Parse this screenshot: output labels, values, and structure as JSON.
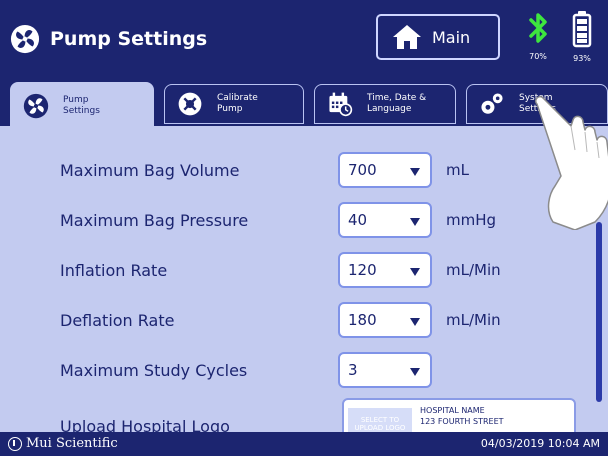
{
  "header": {
    "title": "Pump Settings",
    "main_button_label": "Main",
    "bluetooth_level": "70%",
    "battery_level": "93%",
    "title_icon": "fan-icon",
    "main_icon": "home-icon",
    "bluetooth_icon": "bluetooth-icon",
    "battery_icon": "battery-icon"
  },
  "tabs": [
    {
      "label": "Pump\nSettings",
      "icon": "fan-icon",
      "active": true
    },
    {
      "label": "Calibrate\nPump",
      "icon": "calibrate-icon",
      "active": false
    },
    {
      "label": "Time, Date &\nLanguage",
      "icon": "calendar-clock-icon",
      "active": false
    },
    {
      "label": "System\nSettings",
      "icon": "gears-icon",
      "active": false
    }
  ],
  "settings": [
    {
      "label": "Maximum Bag Volume",
      "value": "700",
      "unit": "mL"
    },
    {
      "label": "Maximum Bag Pressure",
      "value": "40",
      "unit": "mmHg"
    },
    {
      "label": "Inflation Rate",
      "value": "120",
      "unit": "mL/Min"
    },
    {
      "label": "Deflation Rate",
      "value": "180",
      "unit": "mL/Min"
    },
    {
      "label": "Maximum Study Cycles",
      "value": "3",
      "unit": ""
    },
    {
      "label": "Upload Hospital Logo"
    }
  ],
  "logo_card": {
    "select_text": "SELECT TO\nUPLOAD LOGO",
    "hospital_name": "HOSPITAL NAME",
    "hospital_address": "123 FOURTH STREET"
  },
  "footer": {
    "brand": "Mui Scientific",
    "datetime": "04/03/2019 10:04 AM"
  },
  "colors": {
    "navy": "#1c2570",
    "panel": "#c3cbf0",
    "bluetooth": "#3ee63e",
    "select_border": "#7f93e8"
  }
}
